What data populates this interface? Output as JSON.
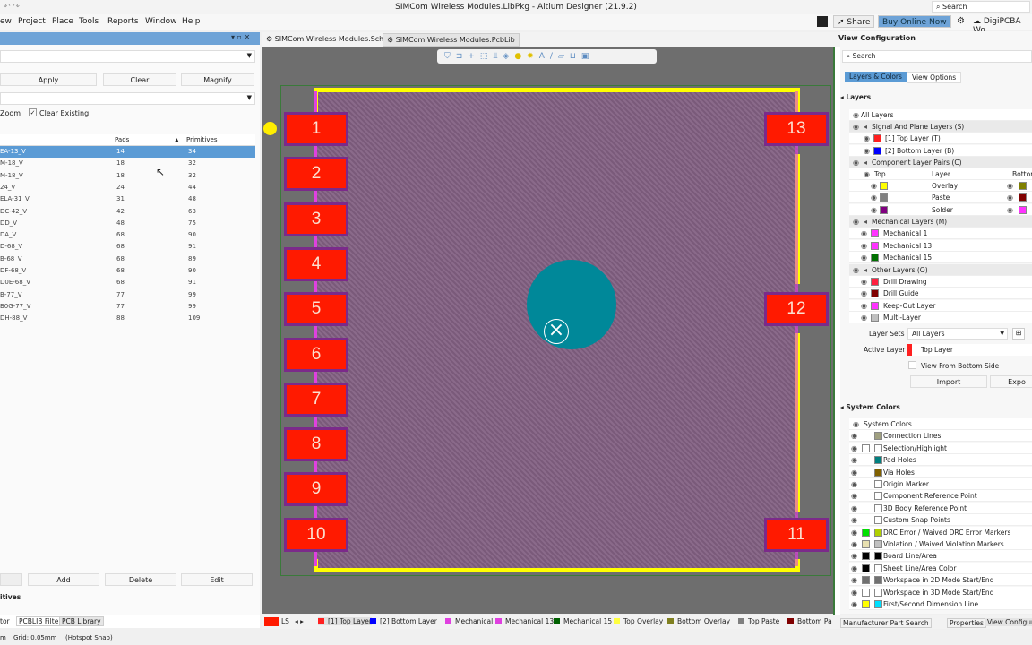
{
  "window": {
    "title": "SIMCom Wireless Modules.LibPkg - Altium Designer (21.9.2)",
    "search_placeholder": "Search"
  },
  "menu": [
    "ew",
    "Project",
    "Place",
    "Tools",
    "Reports",
    "Window",
    "Help"
  ],
  "toolbar_right": {
    "share": "Share",
    "buy": "Buy Online Now",
    "account": "DigiPCBA Wo"
  },
  "doc_tabs": [
    "SIMCom Wireless Modules.SchLib",
    "SIMCom Wireless Modules.PcbLib"
  ],
  "left_panel": {
    "apply": "Apply",
    "clear": "Clear",
    "magnify": "Magnify",
    "zoom_label": "Zoom",
    "clear_existing": "Clear Existing",
    "clear_existing_checked": true,
    "columns": [
      "Pads",
      "Primitives"
    ],
    "rows": [
      [
        "EA-13_V",
        "14",
        "34"
      ],
      [
        "M-18_V",
        "18",
        "32"
      ],
      [
        "M-18_V",
        "18",
        "32"
      ],
      [
        "24_V",
        "24",
        "44"
      ],
      [
        "ELA-31_V",
        "31",
        "48"
      ],
      [
        "DC-42_V",
        "42",
        "63"
      ],
      [
        "DD_V",
        "48",
        "75"
      ],
      [
        "DA_V",
        "68",
        "90"
      ],
      [
        "D-68_V",
        "68",
        "91"
      ],
      [
        "B-68_V",
        "68",
        "89"
      ],
      [
        "DF-68_V",
        "68",
        "90"
      ],
      [
        "D0E-68_V",
        "68",
        "91"
      ],
      [
        "B-77_V",
        "77",
        "99"
      ],
      [
        "B0G-77_V",
        "77",
        "99"
      ],
      [
        "DH-88_V",
        "88",
        "109"
      ]
    ],
    "add": "Add",
    "delete": "Delete",
    "edit": "Edit",
    "primitives_label": "itives",
    "tabs": [
      "tor",
      "PCBLIB Filter",
      "PCB Library"
    ]
  },
  "status": {
    "grid": "Grid: 0.05mm",
    "snap": "(Hotspot Snap)",
    "left": "m"
  },
  "pcb": {
    "left_pads": [
      "1",
      "2",
      "3",
      "4",
      "5",
      "6",
      "7",
      "8",
      "9",
      "10"
    ],
    "right_pads": [
      "13",
      "12",
      "11"
    ],
    "colors": {
      "pad": "#ff1a00",
      "outline": "#ffff00",
      "hole": "#008899",
      "bg": "#6e6e6e"
    }
  },
  "view_config": {
    "title": "View Configuration",
    "search_placeholder": "Search",
    "tabs": [
      "Layers & Colors",
      "View Options"
    ],
    "layers_header": "Layers",
    "all_layers": "All Layers",
    "layers": [
      {
        "label": "Signal And Plane Layers (S)",
        "group": true
      },
      {
        "label": "[1] Top Layer (T)",
        "color": "#ff2020"
      },
      {
        "label": "[2] Bottom Layer (B)",
        "color": "#0000ff"
      },
      {
        "label": "Component Layer Pairs (C)",
        "group": true
      }
    ],
    "pair_header": {
      "top": "Top",
      "layer": "Layer",
      "bottom": "Bottom"
    },
    "pairs": [
      {
        "label": "Overlay",
        "top": "#ffff00",
        "bottom": "#808000"
      },
      {
        "label": "Paste",
        "top": "#808080",
        "bottom": "#800000"
      },
      {
        "label": "Solder",
        "top": "#800080",
        "bottom": "#ff33ff"
      }
    ],
    "layers2": [
      {
        "label": "Mechanical Layers (M)",
        "group": true
      },
      {
        "label": "Mechanical 1",
        "color": "#ff33ff"
      },
      {
        "label": "Mechanical 13",
        "color": "#ff33ff"
      },
      {
        "label": "Mechanical 15",
        "color": "#007000"
      },
      {
        "label": "Other Layers (O)",
        "group": true
      },
      {
        "label": "Drill Drawing",
        "color": "#ff2040"
      },
      {
        "label": "Drill Guide",
        "color": "#800000"
      },
      {
        "label": "Keep-Out Layer",
        "color": "#ff33ff"
      },
      {
        "label": "Multi-Layer",
        "color": "#c0c0c0"
      }
    ],
    "layer_sets_label": "Layer Sets",
    "layer_sets_value": "All Layers",
    "active_layer_label": "Active Layer",
    "active_layer_value": "Top Layer",
    "view_from_bottom": "View From Bottom Side",
    "import": "Import",
    "export": "Expo",
    "system_colors_header": "System Colors",
    "system_colors": [
      {
        "label": "System Colors",
        "group": true
      },
      {
        "label": "Connection Lines",
        "c2": "#a0a080"
      },
      {
        "label": "Selection/Highlight",
        "c1": "#ffffff",
        "c2": "#ffffff"
      },
      {
        "label": "Pad Holes",
        "c2": "#008080"
      },
      {
        "label": "Via Holes",
        "c2": "#806000"
      },
      {
        "label": "Origin Marker",
        "c2": "#ffffff"
      },
      {
        "label": "Component Reference Point",
        "c2": "#ffffff"
      },
      {
        "label": "3D Body Reference Point",
        "c2": "#ffffff"
      },
      {
        "label": "Custom Snap Points",
        "c2": "#ffffff"
      },
      {
        "label": "DRC Error / Waived DRC Error Markers",
        "c1": "#00e000",
        "c2": "#b0d000"
      },
      {
        "label": "Violation / Waived Violation Markers",
        "c1": "#e8e0b0",
        "c2": "#c0c0c0"
      },
      {
        "label": "Board Line/Area",
        "c1": "#000000",
        "c2": "#000000"
      },
      {
        "label": "Sheet Line/Area Color",
        "c1": "#000000",
        "c2": "#ffffff"
      },
      {
        "label": "Workspace in 2D Mode Start/End",
        "c1": "#707070",
        "c2": "#707070"
      },
      {
        "label": "Workspace in 3D Mode Start/End",
        "c1": "#ffffff",
        "c2": "#ffffff"
      },
      {
        "label": "First/Second Dimension Line",
        "c1": "#ffff00",
        "c2": "#00e0ff"
      }
    ],
    "bottom_tabs": [
      "Manufacturer Part Search",
      "Properties",
      "View Configur"
    ]
  },
  "layer_tabs": {
    "ls": "LS",
    "items": [
      {
        "label": "[1] Top Layer",
        "color": "#ff2020"
      },
      {
        "label": "[2] Bottom Layer",
        "color": "#0000ff"
      },
      {
        "label": "Mechanical 1",
        "color": "#e040e0"
      },
      {
        "label": "Mechanical 13",
        "color": "#e040e0"
      },
      {
        "label": "Mechanical 15",
        "color": "#006000"
      },
      {
        "label": "Top Overlay",
        "color": "#ffff40"
      },
      {
        "label": "Bottom Overlay",
        "color": "#808020"
      },
      {
        "label": "Top Paste",
        "color": "#808080"
      },
      {
        "label": "Bottom Pa",
        "color": "#800000"
      }
    ]
  }
}
